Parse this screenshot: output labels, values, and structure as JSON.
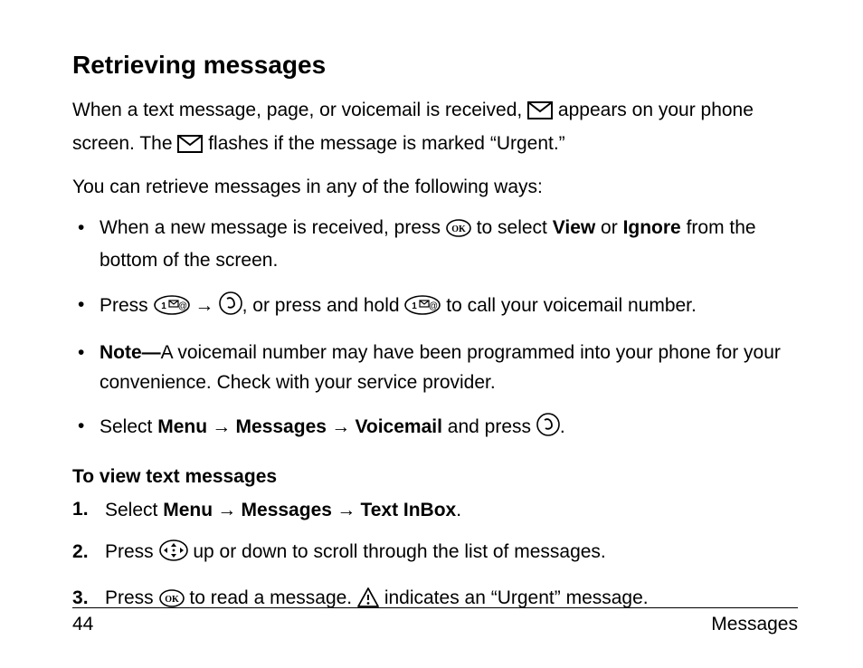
{
  "title": "Retrieving messages",
  "intro": {
    "a": "When a text message, page, or voicemail is received, ",
    "b": " appears on your phone screen. The ",
    "c": " flashes if the message is marked “Urgent.”"
  },
  "lead": "You can retrieve messages in any of the following ways:",
  "bullets": {
    "b1a": "When a new message is received, press ",
    "b1b": " to select ",
    "view": "View",
    "or": " or ",
    "ignore": "Ignore",
    "b1c": " from the bottom of the screen.",
    "b2a": "Press ",
    "b2b": ", or press and hold ",
    "b2c": " to call your voicemail number.",
    "noteLabel": "Note—",
    "b3": "A voicemail number may have been programmed into your phone for your convenience. Check with your service provider.",
    "b4a": "Select ",
    "menu": "Menu",
    "messages": "Messages",
    "voicemail": "Voicemail",
    "b4b": " and press ",
    "period": "."
  },
  "subhead": "To view text messages",
  "steps": {
    "s1a": "Select ",
    "textinbox": "Text InBox",
    "s2a": "Press ",
    "s2b": " up or down to scroll through the list of messages.",
    "s3a": "Press ",
    "s3b": " to read a message. ",
    "s3c": " indicates an “Urgent” message."
  },
  "arrow": " → ",
  "footer": {
    "page": "44",
    "section": "Messages"
  }
}
